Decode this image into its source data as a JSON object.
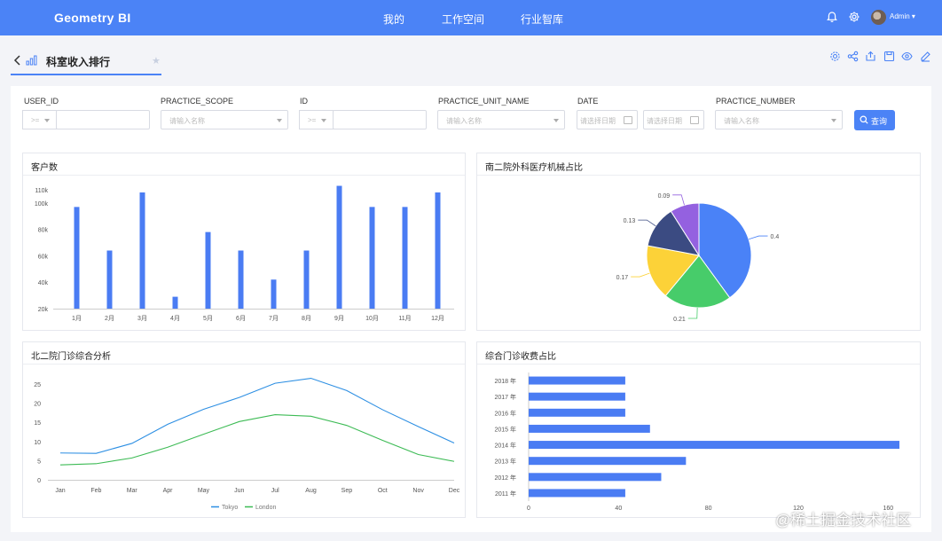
{
  "header": {
    "brand": "Geometry BI",
    "nav": [
      "我的",
      "工作空间",
      "行业智库"
    ],
    "user": "Admin"
  },
  "tab": {
    "title": "科室收入排行"
  },
  "filters": {
    "user_id": {
      "label": "USER_ID",
      "op": ">="
    },
    "practice_scope": {
      "label": "PRACTICE_SCOPE",
      "placeholder": "请输入名称"
    },
    "id": {
      "label": "ID",
      "op": ">="
    },
    "practice_unit_name": {
      "label": "PRACTICE_UNIT_NAME",
      "placeholder": "请输入名称"
    },
    "date": {
      "label": "DATE",
      "start_placeholder": "请选择日期",
      "end_placeholder": "请选择日期"
    },
    "practice_number": {
      "label": "PRACTICE_NUMBER",
      "placeholder": "请输入名称"
    },
    "query_label": "查询"
  },
  "colors": {
    "accent": "#4b83f6",
    "bar": "#4a7cf3",
    "line_tokyo": "#2d8fe3",
    "line_london": "#3dbb55",
    "pie": [
      "#4a82f7",
      "#47cc6a",
      "#fcd238",
      "#3b4b82",
      "#9461e0"
    ]
  },
  "chart_data": [
    {
      "type": "bar",
      "title": "客户数",
      "categories": [
        "1月",
        "2月",
        "3月",
        "4月",
        "5月",
        "6月",
        "7月",
        "8月",
        "9月",
        "10月",
        "11月",
        "12月"
      ],
      "values": [
        97000,
        64000,
        108000,
        29000,
        78000,
        64000,
        42000,
        64000,
        113000,
        97000,
        97000,
        108000
      ],
      "ylim": [
        20000,
        110000
      ],
      "yticks": [
        "20k",
        "40k",
        "60k",
        "80k",
        "100k",
        "110k"
      ]
    },
    {
      "type": "pie",
      "title": "南二院外科医疗机械占比",
      "values": [
        0.4,
        0.21,
        0.17,
        0.13,
        0.09
      ],
      "labels": [
        "0.4",
        "0.21",
        "0.17",
        "0.13",
        "0.09"
      ]
    },
    {
      "type": "line",
      "title": "北二院门诊综合分析",
      "categories": [
        "Jan",
        "Feb",
        "Mar",
        "Apr",
        "May",
        "Jun",
        "Jul",
        "Aug",
        "Sep",
        "Oct",
        "Nov",
        "Dec"
      ],
      "series": [
        {
          "name": "Tokyo",
          "values": [
            7.0,
            6.9,
            9.5,
            14.5,
            18.4,
            21.5,
            25.2,
            26.5,
            23.3,
            18.3,
            13.9,
            9.6
          ]
        },
        {
          "name": "London",
          "values": [
            3.9,
            4.2,
            5.7,
            8.5,
            11.9,
            15.2,
            17.0,
            16.6,
            14.2,
            10.3,
            6.6,
            4.8
          ]
        }
      ],
      "ylim": [
        0,
        25
      ],
      "yticks": [
        0,
        5,
        10,
        15,
        20,
        25
      ],
      "legend": "bottom"
    },
    {
      "type": "bar",
      "orientation": "horizontal",
      "title": "综合门诊收费占比",
      "categories": [
        "2011 年",
        "2012 年",
        "2013 年",
        "2014 年",
        "2015 年",
        "2016 年",
        "2017 年",
        "2018 年"
      ],
      "values": [
        43,
        59,
        70,
        165,
        54,
        43,
        43,
        43
      ],
      "xlim": [
        0,
        165
      ],
      "xticks": [
        0,
        40,
        80,
        120,
        160
      ]
    }
  ],
  "watermark": "@稀土掘金技术社区"
}
